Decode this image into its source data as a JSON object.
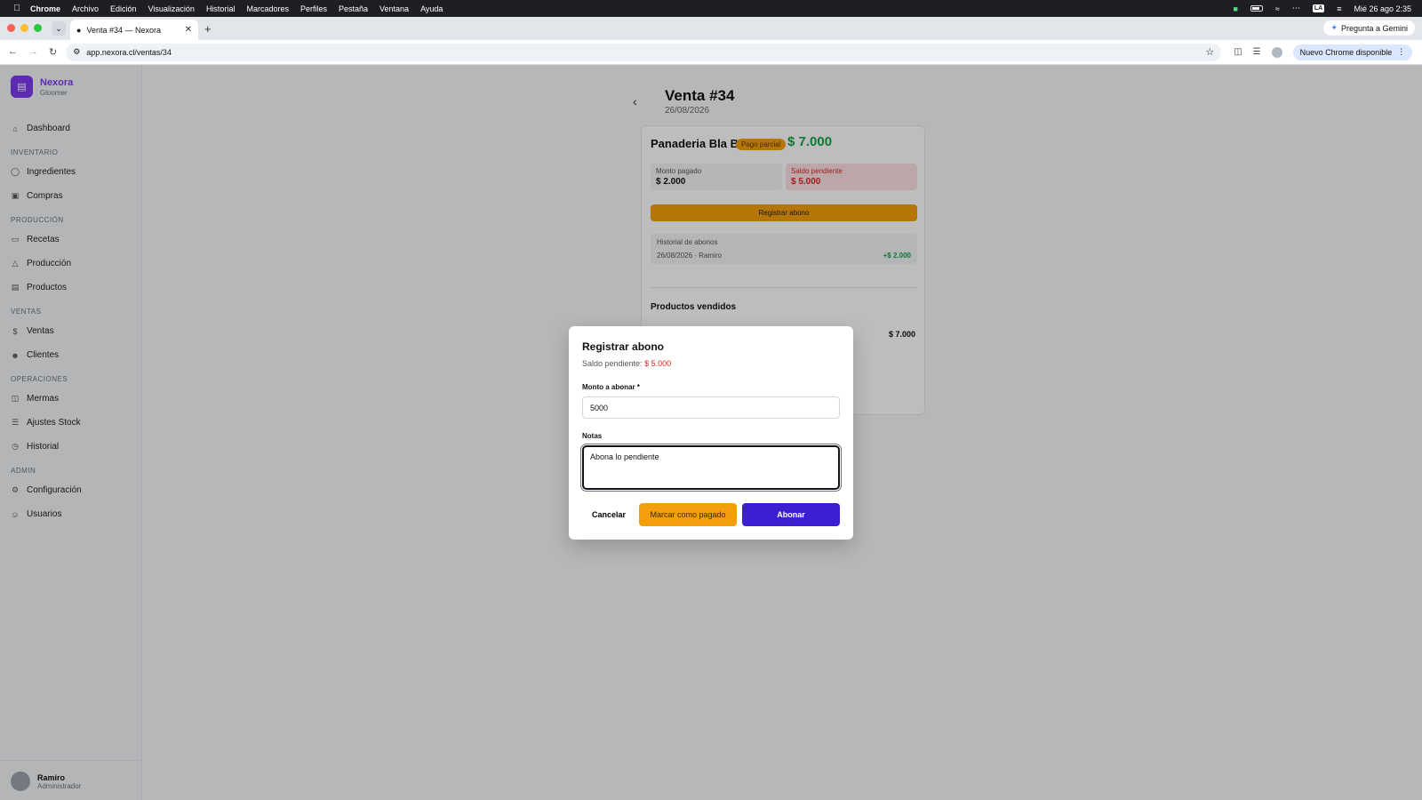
{
  "menubar": {
    "app": "Chrome",
    "menus": [
      "Archivo",
      "Edición",
      "Visualización",
      "Historial",
      "Marcadores",
      "Perfiles",
      "Pestaña",
      "Ventana",
      "Ayuda"
    ],
    "keyboard": "LA",
    "datetime": "Mié 26 ago 2:35"
  },
  "browser": {
    "tab_title": "Venta #34 — Nexora",
    "url": "app.nexora.cl/ventas/34",
    "gemini_label": "Pregunta a Gemini",
    "update_label": "Nuevo Chrome disponible"
  },
  "sidebar": {
    "brand": "Nexora",
    "subtitle": "Gloomer",
    "dashboard": "Dashboard",
    "sections": [
      "INVENTARIO",
      "PRODUCCIÓN",
      "VENTAS",
      "OPERACIONES",
      "ADMIN"
    ],
    "items": [
      "Ingredientes",
      "Compras",
      "Recetas",
      "Producción",
      "Productos",
      "Ventas",
      "Clientes",
      "Mermas",
      "Ajustes Stock",
      "Historial",
      "Configuración",
      "Usuarios"
    ],
    "user_name": "Ramiro",
    "user_role": "Administrador"
  },
  "sale": {
    "title": "Venta #34",
    "date": "26/08/2026",
    "client": "Panaderia Bla Bla",
    "status": "Pago parcial",
    "total": "$ 7.000",
    "paid_label": "Monto pagado",
    "paid_value": "$ 2.000",
    "pending_label": "Saldo pendiente",
    "pending_value": "$ 5.000",
    "register_button": "Registrar abono",
    "history_title": "Historial de abonos",
    "history_entry": "26/08/2026 · Ramiro",
    "history_amount": "+$ 2.000",
    "products_title": "Productos vendidos",
    "product_amount": "$ 7.000"
  },
  "modal": {
    "title": "Registrar abono",
    "pending_prefix": "Saldo pendiente:",
    "pending_value": "$ 5.000",
    "amount_label": "Monto a abonar *",
    "amount_value": "5000",
    "notes_label": "Notas",
    "notes_value": "Abona lo pendiente",
    "cancel": "Cancelar",
    "mark_paid": "Marcar como pagado",
    "submit": "Abonar"
  },
  "colors": {
    "brand": "#7c3aed",
    "primary": "#3b1fd1",
    "warning": "#f59e0b",
    "success": "#16a34a",
    "danger": "#dc2626"
  }
}
